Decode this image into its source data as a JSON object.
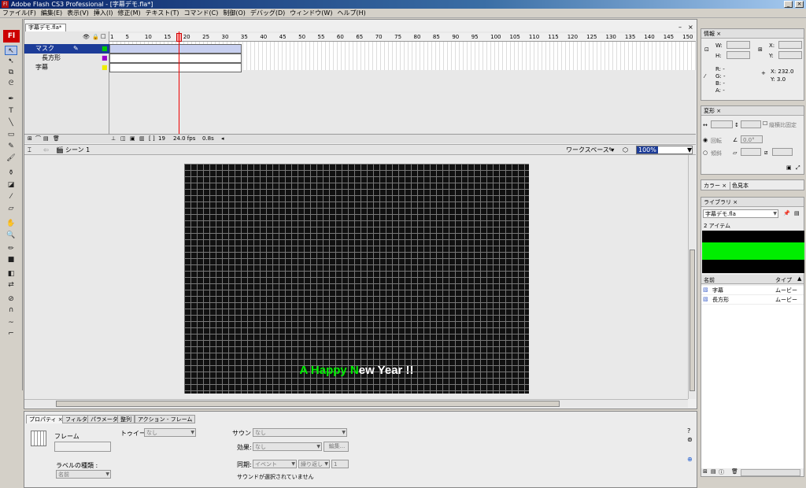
{
  "window": {
    "title": "Adobe Flash CS3 Professional - [字幕デモ.fla*]"
  },
  "menu": [
    "ファイル(F)",
    "編集(E)",
    "表示(V)",
    "挿入(I)",
    "修正(M)",
    "テキスト(T)",
    "コマンド(C)",
    "制御(O)",
    "デバッグ(D)",
    "ウィンドウ(W)",
    "ヘルプ(H)"
  ],
  "document": {
    "tab": "字幕デモ.fla*"
  },
  "timeline": {
    "layers": [
      {
        "name": "マスク",
        "active": true
      },
      {
        "name": "長方形",
        "active": false
      },
      {
        "name": "字幕",
        "active": false
      }
    ],
    "ruler": [
      "1",
      "5",
      "10",
      "15",
      "20",
      "25",
      "30",
      "35",
      "40",
      "45",
      "50",
      "55",
      "60",
      "65",
      "70",
      "75",
      "80",
      "85",
      "90",
      "95",
      "100",
      "105",
      "110",
      "115",
      "120",
      "125",
      "130",
      "135",
      "140",
      "145",
      "150"
    ],
    "current_frame": "19",
    "fps": "24.0 fps",
    "time": "0.8s"
  },
  "editbar": {
    "scene": "シーン 1",
    "workspace": "ワークスペース ▾",
    "zoom": "100%"
  },
  "stage": {
    "headline_parts": [
      "A Happy N",
      "e",
      "w Year !!"
    ]
  },
  "properties": {
    "tabs": [
      "プロパティ ×",
      "フィルタ",
      "パラメータ",
      "整列",
      "アクション - フレーム"
    ],
    "frame_label": "フレーム",
    "tween_label": "トゥイーン:",
    "tween_value": "なし",
    "sound_label": "サウンド:",
    "sound_value": "なし",
    "effect_label": "効果:",
    "effect_value": "なし",
    "edit_button": "編集...",
    "label_type": "ラベルの種類 :",
    "label_type_value": "名前",
    "sync_label": "同期:",
    "sync_value": "イベント",
    "repeat_value": "繰り返し",
    "repeat_count": "1",
    "no_sound": "サウンドが選択されていません"
  },
  "info_panel": {
    "tab": "情報 ×",
    "w": "W:",
    "h": "H:",
    "x": "X:",
    "y": "Y:",
    "r": "R:  -",
    "g": "G:  -",
    "b": "B:  -",
    "a": "A:  -",
    "cx": "X: 232.0",
    "cy": "Y: 3.0"
  },
  "transform_panel": {
    "tab": "変形 ×",
    "constrain": "縦横比固定",
    "rotate": "回転",
    "rotate_value": "0.0°",
    "skew": "傾斜"
  },
  "color_panel": {
    "tabs": [
      "カラー ×",
      "色見本"
    ]
  },
  "library_panel": {
    "tab": "ライブラリ ×",
    "file": "字幕デモ.fla",
    "count": "2 アイテム",
    "col_name": "名前",
    "col_type": "タイプ",
    "items": [
      {
        "name": "字幕",
        "type": "ムービー"
      },
      {
        "name": "長方形",
        "type": "ムービー"
      }
    ]
  },
  "colors": {
    "accent": "#1c3c98",
    "green": "#00ee00",
    "white": "#ffffff"
  }
}
